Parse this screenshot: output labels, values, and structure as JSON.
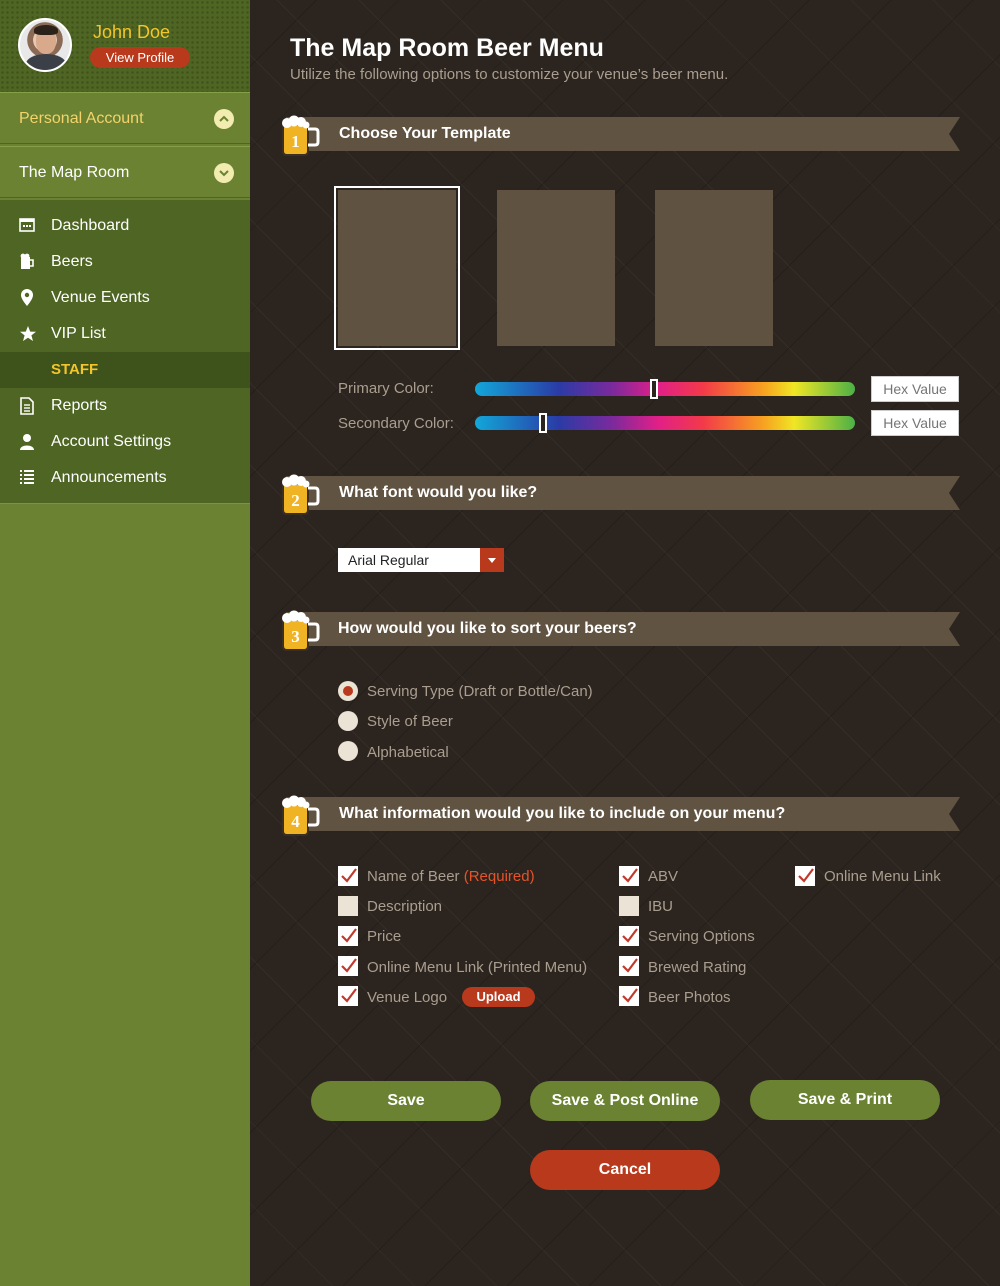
{
  "profile": {
    "name": "John Doe",
    "view_profile": "View Profile"
  },
  "sidebar": {
    "accounts": [
      {
        "label": "Personal Account",
        "icon": "chevron-up-icon"
      },
      {
        "label": "The Map Room",
        "icon": "chevron-down-icon"
      }
    ],
    "nav": [
      {
        "label": "Dashboard",
        "icon": "dashboard-icon"
      },
      {
        "label": "Beers",
        "icon": "beer-mug-icon"
      },
      {
        "label": "Venue Events",
        "icon": "map-pin-icon"
      },
      {
        "label": "VIP List",
        "icon": "star-icon"
      },
      {
        "label": "STAFF",
        "active": true
      },
      {
        "label": "Reports",
        "icon": "document-icon"
      },
      {
        "label": "Account Settings",
        "icon": "user-icon"
      },
      {
        "label": "Announcements",
        "icon": "list-icon"
      }
    ]
  },
  "page": {
    "title": "The Map Room Beer Menu",
    "subtitle": "Utilize the following options to customize your venue’s beer menu."
  },
  "sections": [
    {
      "number": "1",
      "title": "Choose Your Template"
    },
    {
      "number": "2",
      "title": "What font would you like?"
    },
    {
      "number": "3",
      "title": "How would you like to sort your beers?"
    },
    {
      "number": "4",
      "title": "What information would you like to include on your menu?"
    }
  ],
  "template": {
    "selected_index": 0,
    "count": 3
  },
  "colors": {
    "primary_label": "Primary Color:",
    "secondary_label": "Secondary Color:",
    "primary_position": 0.47,
    "secondary_position": 0.18,
    "hex_placeholder": "Hex Value"
  },
  "font": {
    "selected": "Arial Regular"
  },
  "sort": {
    "options": [
      "Serving Type (Draft or Bottle/Can)",
      "Style of Beer",
      "Alphabetical"
    ],
    "selected_index": 0
  },
  "info": {
    "required_tag": "(Required)",
    "col1": [
      {
        "label": "Name of Beer",
        "checked": true
      },
      {
        "label": "Description",
        "checked": false
      },
      {
        "label": "Price",
        "checked": true
      },
      {
        "label": "Online Menu Link (Printed Menu)",
        "checked": true
      },
      {
        "label": "Venue Logo",
        "checked": true
      }
    ],
    "col2": [
      {
        "label": "ABV",
        "checked": true
      },
      {
        "label": "IBU",
        "checked": false
      },
      {
        "label": "Serving Options",
        "checked": true
      },
      {
        "label": "Brewed Rating",
        "checked": true
      },
      {
        "label": "Beer Photos",
        "checked": true
      }
    ],
    "col3": [
      {
        "label": "Online Menu Link",
        "checked": true
      }
    ],
    "upload_label": "Upload"
  },
  "actions": {
    "save": "Save",
    "save_post": "Save & Post Online",
    "save_print": "Save & Print",
    "cancel": "Cancel"
  },
  "theme": {
    "accent_green": "#6a8231",
    "accent_red": "#b8391c",
    "gold": "#f4c52a"
  }
}
